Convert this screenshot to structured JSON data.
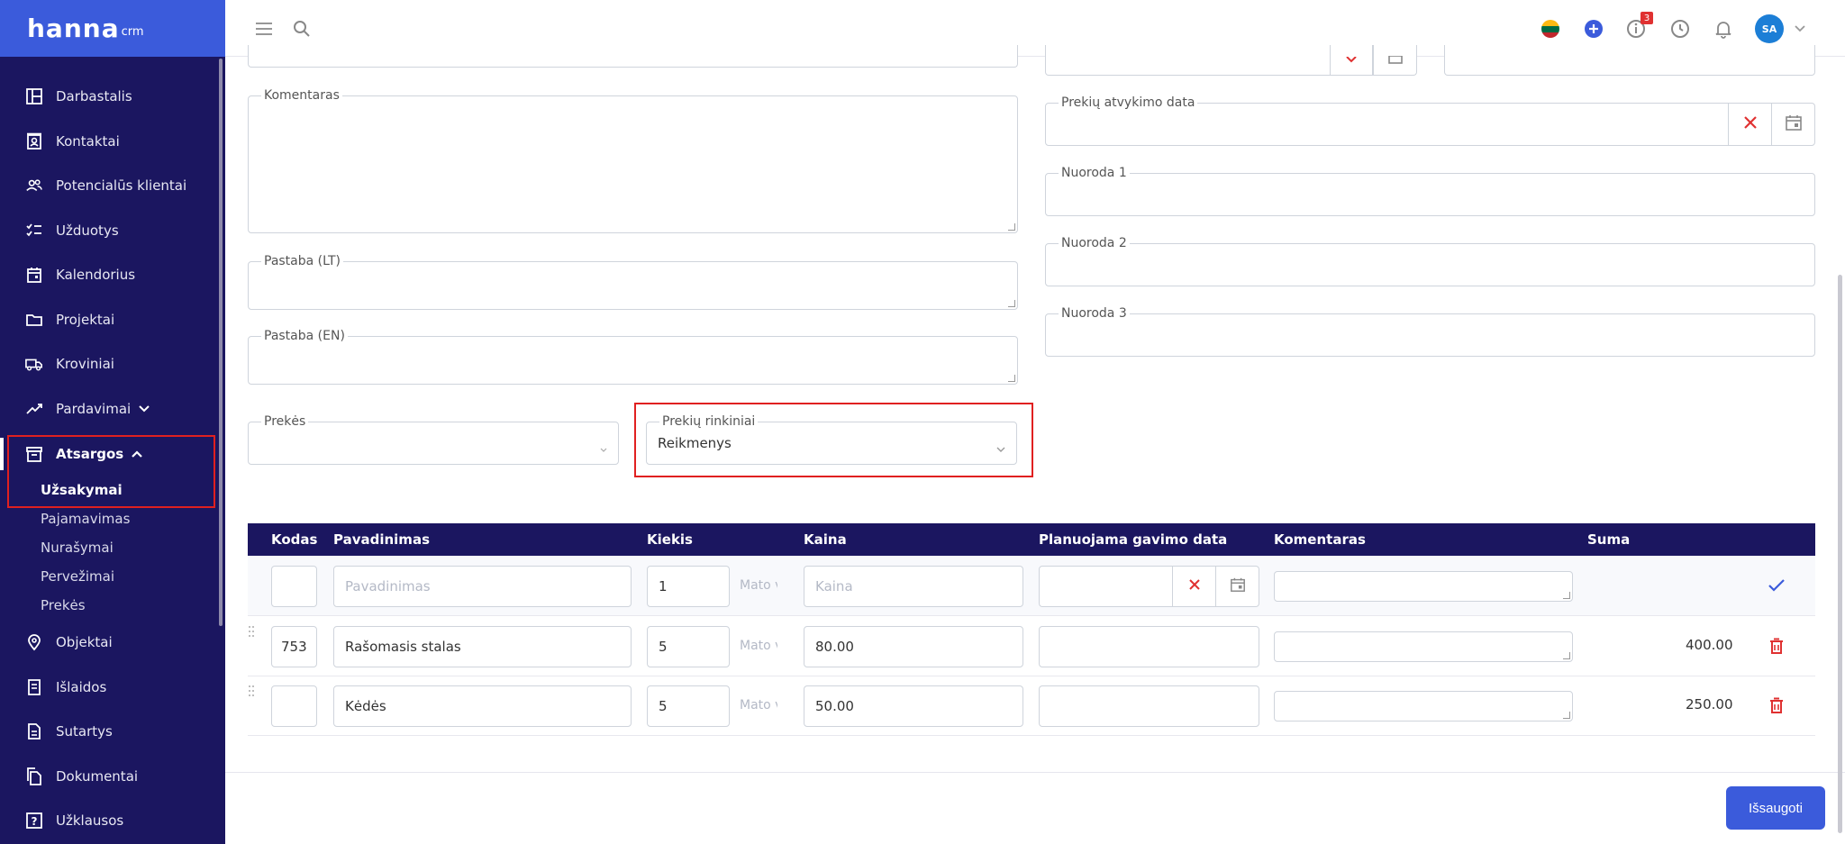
{
  "app": {
    "logo_main": "hanna",
    "logo_sub": "crm"
  },
  "sidebar": {
    "items": [
      {
        "label": "Darbastalis",
        "icon": "dashboard-icon"
      },
      {
        "label": "Kontaktai",
        "icon": "contacts-icon"
      },
      {
        "label": "Potencialūs klientai",
        "icon": "leads-icon"
      },
      {
        "label": "Užduotys",
        "icon": "tasks-icon"
      },
      {
        "label": "Kalendorius",
        "icon": "calendar-icon"
      },
      {
        "label": "Projektai",
        "icon": "folder-icon"
      },
      {
        "label": "Kroviniai",
        "icon": "truck-icon"
      },
      {
        "label": "Pardavimai",
        "icon": "trend-icon"
      },
      {
        "label": "Atsargos",
        "icon": "archive-icon"
      },
      {
        "label": "Objektai",
        "icon": "pin-icon"
      },
      {
        "label": "Išlaidos",
        "icon": "receipt-icon"
      },
      {
        "label": "Sutartys",
        "icon": "document-icon"
      },
      {
        "label": "Dokumentai",
        "icon": "documents-icon"
      },
      {
        "label": "Užklausos",
        "icon": "question-icon"
      }
    ],
    "sub_items": [
      "Užsakymai",
      "Pajamavimas",
      "Nurašymai",
      "Pervežimai",
      "Prekės"
    ]
  },
  "topbar": {
    "badge_count": "3",
    "avatar_initials": "SA",
    "flag": "lithuania-flag"
  },
  "form": {
    "komentaras_label": "Komentaras",
    "pastaba_lt_label": "Pastaba (LT)",
    "pastaba_en_label": "Pastaba (EN)",
    "prekes_label": "Prekės",
    "prekiu_rinkiniai_label": "Prekių rinkiniai",
    "prekiu_rinkiniai_value": "Reikmenys",
    "atvykimo_data_label": "Prekių atvykimo data",
    "nuoroda1_label": "Nuoroda 1",
    "nuoroda2_label": "Nuoroda 2",
    "nuoroda3_label": "Nuoroda 3"
  },
  "table": {
    "headers": [
      "Kodas",
      "Pavadinimas",
      "Kiekis",
      "Kaina",
      "Planuojama gavimo data",
      "Komentaras",
      "Suma"
    ],
    "new_row": {
      "name_placeholder": "Pavadinimas",
      "qty": "1",
      "unit_placeholder": "Mato vnt.",
      "price_placeholder": "Kaina"
    },
    "rows": [
      {
        "code": "753",
        "name": "Rašomasis stalas",
        "qty": "5",
        "unit": "Mato vnt.",
        "price": "80.00",
        "sum": "400.00"
      },
      {
        "code": "",
        "name": "Kėdės",
        "qty": "5",
        "unit": "Mato vnt.",
        "price": "50.00",
        "sum": "250.00"
      }
    ]
  },
  "save_label": "Išsaugoti",
  "colors": {
    "sidebar": "#1b1660",
    "accent": "#3b5bdb",
    "danger": "#e03131",
    "highlight": "#e02020"
  }
}
